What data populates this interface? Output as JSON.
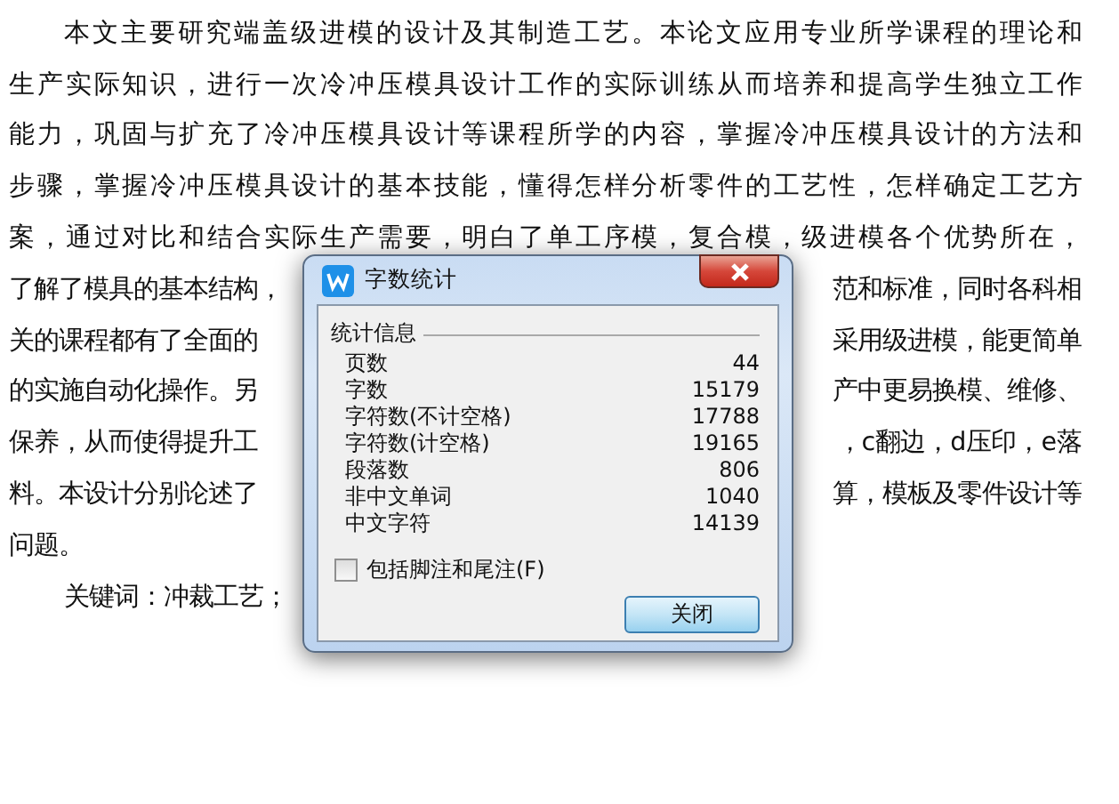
{
  "document": {
    "paragraphs": [
      {
        "lines": [
          {
            "left": "本文主要研究端盖级进模的设计及其制造工艺。本论文应用专业所学课程的理论和"
          },
          {
            "left": "生产实际知识，进行一次冷冲压模具设计工作的实际训练从而培养和提高学生独立工作"
          },
          {
            "left": "能力，巩固与扩充了冷冲压模具设计等课程所学的内容，掌握冷冲压模具设计的方法和"
          },
          {
            "left": "步骤，掌握冷冲压模具设计的基本技能，懂得怎样分析零件的工艺性，怎样确定工艺方"
          },
          {
            "left": "案，通过对比和结合实际生产需要，明白了单工序模，复合模，级进模各个优势所在，"
          },
          {
            "left": "了解了模具的基本结构，",
            "right": "范和标准，同时各科相"
          },
          {
            "left": "关的课程都有了全面的",
            "right": "采用级进模，能更简单"
          },
          {
            "left": "的实施自动化操作。另",
            "right": "产中更易换模、维修、"
          },
          {
            "left": "保养，从而使得提升工",
            "right": "，c翻边，d压印，e落"
          },
          {
            "left": "料。本设计分别论述了",
            "right": "算，模板及零件设计等"
          },
          {
            "left": "问题。"
          }
        ]
      },
      {
        "lines": [
          {
            "left": "关键词：冲裁工艺；"
          }
        ]
      }
    ]
  },
  "dialog": {
    "title": "字数统计",
    "group": "统计信息",
    "stats": [
      {
        "label": "页数",
        "value": "44"
      },
      {
        "label": "字数",
        "value": "15179"
      },
      {
        "label": "字符数(不计空格)",
        "value": "17788"
      },
      {
        "label": "字符数(计空格)",
        "value": "19165"
      },
      {
        "label": "段落数",
        "value": "806"
      },
      {
        "label": "非中文单词",
        "value": "1040"
      },
      {
        "label": "中文字符",
        "value": "14139"
      }
    ],
    "checkbox": {
      "label": "包括脚注和尾注(F)",
      "checked": false
    },
    "button": "关闭"
  }
}
